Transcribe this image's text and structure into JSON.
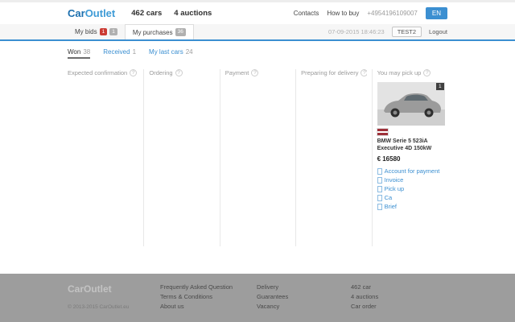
{
  "ui": {
    "help": "?"
  },
  "header": {
    "logo_car": "Car",
    "logo_outlet": "Outlet",
    "cars_count": "462 cars",
    "auctions_count": "4 auctions",
    "contacts": "Contacts",
    "how_to_buy": "How to buy",
    "phone": "+4954196109007",
    "lang": "EN"
  },
  "tabbar": {
    "my_bids": "My bids",
    "my_bids_badge_red": "1",
    "my_bids_badge_gray": "1",
    "my_purchases": "My purchases",
    "my_purchases_badge": "36",
    "datetime": "07-09-2015 18:46:23",
    "user": "TEST2",
    "logout": "Logout"
  },
  "subtabs": [
    {
      "label": "Won",
      "count": "38"
    },
    {
      "label": "Received",
      "count": "1"
    },
    {
      "label": "My last cars",
      "count": "24"
    }
  ],
  "board": {
    "columns": [
      {
        "title": "Expected confirmation"
      },
      {
        "title": "Ordering"
      },
      {
        "title": "Payment"
      },
      {
        "title": "Preparing for delivery"
      },
      {
        "title": "You may pick up"
      }
    ]
  },
  "card": {
    "badge": "1",
    "title": "BMW Serie 5 523iA Executive 4D 150kW",
    "price": "€ 16580",
    "links": [
      {
        "label": "Account for payment"
      },
      {
        "label": "Invoice"
      },
      {
        "label": "Pick up"
      },
      {
        "label": "Ca"
      },
      {
        "label": "Brief"
      }
    ]
  },
  "footer": {
    "logo": "CarOutlet",
    "copyright": "© 2013-2015 CarOutlet.eu",
    "col1": [
      "Frequently Asked Question",
      "Terms & Conditions",
      "About us"
    ],
    "col2": [
      "Delivery",
      "Guarantees",
      "Vacancy"
    ],
    "col3": [
      "462 car",
      "4 auctions",
      "Car order"
    ]
  },
  "colors": {
    "accent": "#3b8fd1",
    "badge_red": "#cc3b33"
  }
}
